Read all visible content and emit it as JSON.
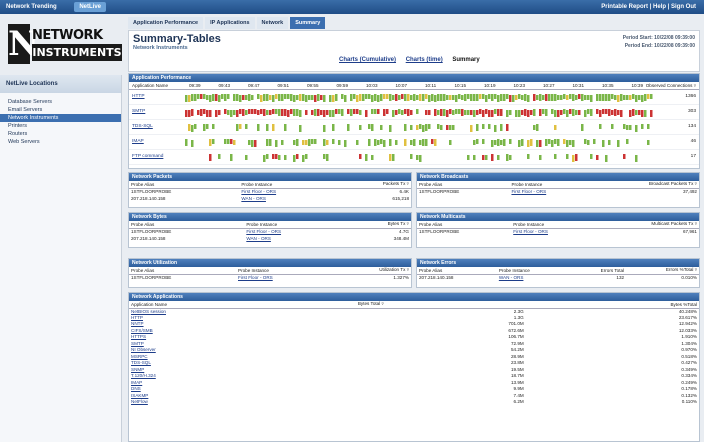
{
  "topbar": {
    "tabs": [
      "Network Trending",
      "NetLive"
    ],
    "right": "Printable Report | Help | Sign Out"
  },
  "logo": {
    "line1": "NETWORK",
    "line2": "INSTRUMENTS",
    "mark": "N"
  },
  "sidebar": {
    "title": "NetLive Locations",
    "items": [
      "Database Servers",
      "Email Servers",
      "Network Instruments",
      "Printers",
      "Routers",
      "Web Servers"
    ],
    "active": 2
  },
  "tabs": [
    "Application Performance",
    "IP Applications",
    "Network",
    "Summary"
  ],
  "header": {
    "title": "Summary-Tables",
    "subtitle": "Network Instruments",
    "period_start": "Period Start: 10/22/08 09:39:00",
    "period_end": "Period End: 10/22/08 09:39:00",
    "links": [
      "Charts (Cumulative)",
      "Charts (time)",
      "Summary"
    ]
  },
  "app_perf": {
    "title": "Application Performance",
    "col_name": "Application Name",
    "times": [
      "09:39",
      "09:43",
      "09:47",
      "09:51",
      "09:55",
      "09:59",
      "10:03",
      "10:07",
      "10:11",
      "10:15",
      "10:19",
      "10:23",
      "10:27",
      "10:31",
      "10:35",
      "10:39"
    ],
    "col_obs": "Observed Connections ▿",
    "rows": [
      {
        "name": "HTTP",
        "value": "1366"
      },
      {
        "name": "SMTP",
        "value": "303"
      },
      {
        "name": "TDS-SQL",
        "value": "134"
      },
      {
        "name": "IMAP",
        "value": "46"
      },
      {
        "name": "FTP command",
        "value": "17"
      }
    ]
  },
  "colors": {
    "green": "#7ab648",
    "red": "#cc3333",
    "yellow": "#e0c040",
    "header": "#3c6fb0"
  },
  "net_packets": {
    "title": "Network Packets",
    "cols": [
      "Probe Alias",
      "Probe Instance",
      "Packets Tx ▿"
    ],
    "rows": [
      [
        "1STFLOORPROBE",
        "First Floor - ORS",
        "6.4K"
      ],
      [
        "207.218.140.158",
        "WAN - ORS",
        "615,218"
      ]
    ]
  },
  "net_broadcasts": {
    "title": "Network Broadcasts",
    "cols": [
      "Probe Alias",
      "Probe Instance",
      "Broadcast Packets Tx ▿"
    ],
    "rows": [
      [
        "1STFLOORPROBE",
        "First Floor - ORS",
        "37,492"
      ]
    ]
  },
  "net_bytes": {
    "title": "Network Bytes",
    "cols": [
      "Probe Alias",
      "Probe Instance",
      "Bytes Tx ▿"
    ],
    "rows": [
      [
        "1STFLOORPROBE",
        "First Floor - ORS",
        "4.7G"
      ],
      [
        "207.218.140.158",
        "WAN - ORS",
        "348.4M"
      ]
    ]
  },
  "net_multicasts": {
    "title": "Network Multicasts",
    "cols": [
      "Probe Alias",
      "Probe Instance",
      "Multicast Packets Tx ▿"
    ],
    "rows": [
      [
        "1STFLOORPROBE",
        "First Floor - ORS",
        "67,961"
      ]
    ]
  },
  "net_util": {
    "title": "Network Utilization",
    "cols": [
      "Probe Alias",
      "Probe Instance",
      "Utilization Tx ▿"
    ],
    "rows": [
      [
        "1STFLOORPROBE",
        "First Floor - ORS",
        "1.327%"
      ]
    ]
  },
  "net_errors": {
    "title": "Network Errors",
    "cols": [
      "Probe Alias",
      "Probe Instance",
      "Errors Total",
      "Errors %Total ▿"
    ],
    "rows": [
      [
        "207.218.140.158",
        "WAN - ORS",
        "132",
        "0.010%"
      ]
    ]
  },
  "net_apps": {
    "title": "Network Applications",
    "cols": [
      "Application Name",
      "Bytes Total ▿",
      "Bytes %Total"
    ],
    "rows": [
      [
        "NetBIOS session",
        "2.3G",
        "40.248%"
      ],
      [
        "HTTP",
        "1.3G",
        "23.617%"
      ],
      [
        "NNTP",
        "701.0M",
        "12.942%"
      ],
      [
        "CIFS/SMB",
        "672.6M",
        "12.033%"
      ],
      [
        "HTTPS",
        "106.7M",
        "1.910%"
      ],
      [
        "SMTP",
        "72.9M",
        "1.304%"
      ],
      [
        "NI Observer",
        "54.2M",
        "0.970%"
      ],
      [
        "MSRPC",
        "28.9M",
        "0.518%"
      ],
      [
        "TDS-SQL",
        "23.8M",
        "0.427%"
      ],
      [
        "SNMP",
        "19.5M",
        "0.349%"
      ],
      [
        "T.120/H.324",
        "18.7M",
        "0.334%"
      ],
      [
        "IMAP",
        "13.9M",
        "0.249%"
      ],
      [
        "DNS",
        "9.9M",
        "0.178%"
      ],
      [
        "ISAKMP",
        "7.4M",
        "0.132%"
      ],
      [
        "NetFlow",
        "6.2M",
        "0.110%"
      ]
    ]
  }
}
